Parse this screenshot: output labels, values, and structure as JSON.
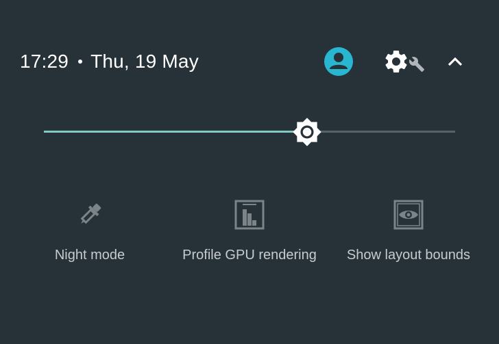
{
  "status": {
    "time": "17:29",
    "date": "Thu, 19 May"
  },
  "header_icons": {
    "avatar": "account-circle-icon",
    "settings": "settings-gear-icon",
    "developer": "wrench-icon",
    "collapse": "chevron-up-icon"
  },
  "brightness": {
    "level": 0.64,
    "icon": "brightness-icon"
  },
  "tiles": [
    {
      "label": "Night mode",
      "icon": "eyedropper-icon"
    },
    {
      "label": "Profile GPU rendering",
      "icon": "gpu-bars-icon"
    },
    {
      "label": "Show layout bounds",
      "icon": "layout-bounds-eye-icon"
    }
  ],
  "colors": {
    "background": "#263238",
    "accent": "#80cbc4",
    "avatar": "#29b6d1",
    "track_inactive": "#56636a",
    "tile_inactive": "#7a8489"
  }
}
